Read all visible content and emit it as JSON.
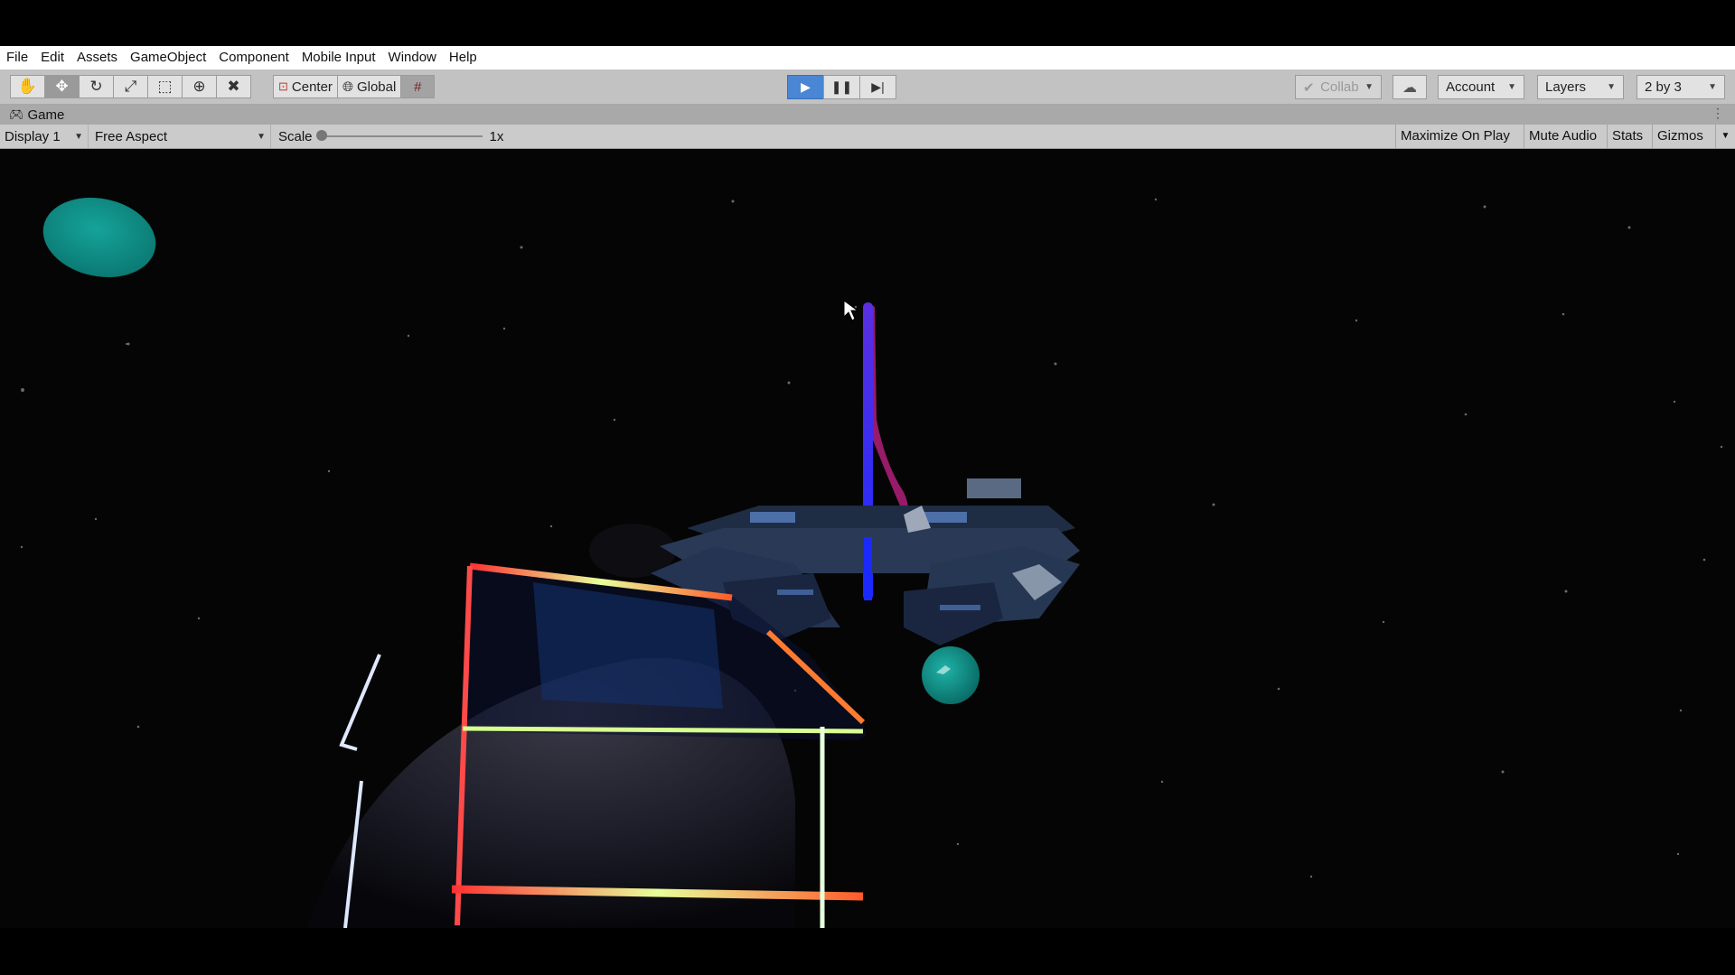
{
  "menubar": {
    "items": [
      "File",
      "Edit",
      "Assets",
      "GameObject",
      "Component",
      "Mobile Input",
      "Window",
      "Help"
    ]
  },
  "toolbar": {
    "tools": [
      {
        "name": "hand-tool",
        "icon": "hand-icon"
      },
      {
        "name": "move-tool",
        "icon": "move-icon"
      },
      {
        "name": "rotate-tool",
        "icon": "rotate-icon"
      },
      {
        "name": "scale-tool",
        "icon": "scale-icon"
      },
      {
        "name": "rect-tool",
        "icon": "rect-icon"
      },
      {
        "name": "transform-tool",
        "icon": "transform-icon"
      },
      {
        "name": "custom-tool",
        "icon": "tools-icon"
      }
    ],
    "pivot_mode": "Center",
    "pivot_rotation": "Global",
    "collab": "Collab",
    "account": "Account",
    "layers": "Layers",
    "layout": "2 by 3"
  },
  "game_tab": {
    "title": "Game"
  },
  "game_bar": {
    "display": "Display 1",
    "aspect": "Free Aspect",
    "scale_label": "Scale",
    "scale_value": "1x",
    "maximize_on_play": "Maximize On Play",
    "mute_audio": "Mute Audio",
    "stats": "Stats",
    "gizmos": "Gizmos"
  },
  "colors": {
    "play_active": "#4a86d3",
    "teal_planet": "#0d8a83",
    "space": "#050505"
  }
}
